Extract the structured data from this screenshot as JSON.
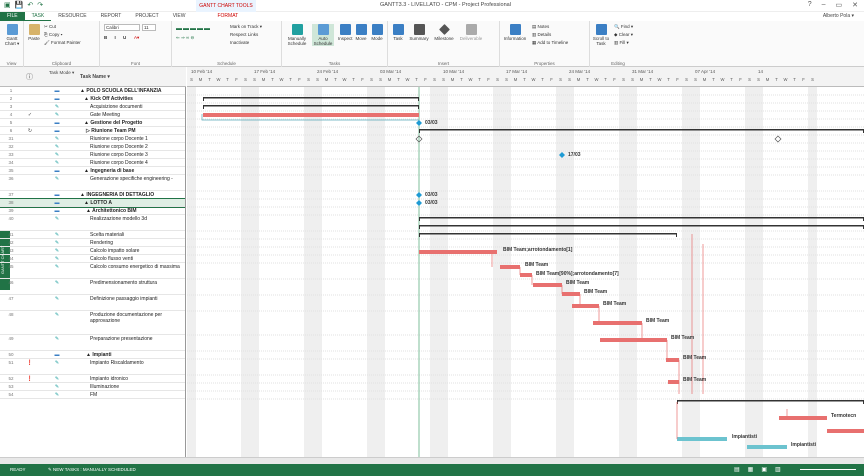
{
  "window": {
    "title": "GANTT3.3 - LIVELLATO - CPM - Project Professional",
    "tools_label": "GANTT CHART TOOLS",
    "user": "Alberto Pola ▾",
    "controls": [
      "?",
      "–",
      "▭",
      "✕"
    ]
  },
  "tabs": [
    "FILE",
    "TASK",
    "RESOURCE",
    "REPORT",
    "PROJECT",
    "VIEW",
    "FORMAT"
  ],
  "ribbon": {
    "groups": [
      "View",
      "Clipboard",
      "Font",
      "Schedule",
      "Tasks",
      "Insert",
      "Properties",
      "Editing"
    ],
    "view_btn": "Gantt Chart ▾",
    "paste": "Paste",
    "cut": "Cut",
    "copy": "Copy ▾",
    "format_painter": "Format Painter",
    "font_name": "Calibri",
    "font_size": "11",
    "mark_on_track": "Mark on Track ▾",
    "respect_links": "Respect Links",
    "inactivate": "Inactivate",
    "manually_schedule": "Manually Schedule",
    "auto_schedule": "Auto Schedule",
    "inspect": "Inspect",
    "move": "Move",
    "mode": "Mode",
    "task": "Task",
    "summary": "Summary",
    "milestone": "Milestone",
    "deliverable": "Deliverable",
    "information": "Information",
    "notes": "Notes",
    "details": "Details",
    "add_to_timeline": "Add to Timeline",
    "scroll_to_task": "Scroll to Task",
    "find": "Find ▾",
    "clear": "Clear ▾",
    "fill": "Fill ▾"
  },
  "grid": {
    "hdr_mode": "Task Mode ▾",
    "hdr_name": "Task Name ▾",
    "rows": [
      {
        "id": "1",
        "ind": "",
        "mode": "▬",
        "name": "▲ POLO SCUOLA DELL'INFANZIA",
        "bold": true
      },
      {
        "id": "2",
        "ind": "",
        "mode": "▬",
        "name": "▲ Kick Off Activities",
        "bold": true
      },
      {
        "id": "3",
        "ind": "",
        "mode": "✎",
        "name": "Acquisizione documenti",
        "bold": false
      },
      {
        "id": "4",
        "ind": "✓",
        "mode": "✎",
        "name": "Gate Meeting",
        "bold": false
      },
      {
        "id": "5",
        "ind": "",
        "mode": "▬",
        "name": "▲ Gestione del Progetto",
        "bold": true
      },
      {
        "id": "6",
        "ind": "↻",
        "mode": "▬",
        "name": "▷ Riunione Team PM",
        "bold": true
      },
      {
        "id": "31",
        "ind": "",
        "mode": "✎",
        "name": "Riunione corpo Docente 1",
        "bold": false
      },
      {
        "id": "32",
        "ind": "",
        "mode": "✎",
        "name": "Riunione corpo Docente 2",
        "bold": false
      },
      {
        "id": "33",
        "ind": "",
        "mode": "✎",
        "name": "Riunione corpo Docente 3",
        "bold": false
      },
      {
        "id": "34",
        "ind": "",
        "mode": "✎",
        "name": "Riunione corpo Docente 4",
        "bold": false
      },
      {
        "id": "35",
        "ind": "",
        "mode": "▬",
        "name": "▲ Ingegneria di base",
        "bold": true
      },
      {
        "id": "36",
        "ind": "",
        "mode": "✎",
        "name": "Generazione specifiche engineering -",
        "bold": false
      },
      {
        "id": "37",
        "ind": "",
        "mode": "▬",
        "name": "▲ INGEGNERIA DI DETTAGLIO",
        "bold": true
      },
      {
        "id": "38",
        "ind": "",
        "mode": "▬",
        "name": "▲ LOTTO A",
        "bold": true
      },
      {
        "id": "39",
        "ind": "",
        "mode": "▬",
        "name": "▲ Architettonico BIM",
        "bold": true
      },
      {
        "id": "40",
        "ind": "",
        "mode": "✎",
        "name": "Realizzazione modello 3d",
        "bold": false
      },
      {
        "id": "41",
        "ind": "",
        "mode": "✎",
        "name": "Scelta materiali",
        "bold": false
      },
      {
        "id": "42",
        "ind": "",
        "mode": "✎",
        "name": "Rendering",
        "bold": false
      },
      {
        "id": "43",
        "ind": "",
        "mode": "✎",
        "name": "Calcolo impatto solare",
        "bold": false
      },
      {
        "id": "44",
        "ind": "",
        "mode": "✎",
        "name": "Calcolo flusso venti",
        "bold": false
      },
      {
        "id": "45",
        "ind": "",
        "mode": "✎",
        "name": "Calcolo consumo energetico di massima",
        "bold": false
      },
      {
        "id": "46",
        "ind": "",
        "mode": "✎",
        "name": "Predimensionamento struttura",
        "bold": false
      },
      {
        "id": "47",
        "ind": "",
        "mode": "✎",
        "name": "Definizione passaggio impianti",
        "bold": false
      },
      {
        "id": "48",
        "ind": "",
        "mode": "✎",
        "name": "Produzione documentazione per approvazione",
        "bold": false
      },
      {
        "id": "49",
        "ind": "",
        "mode": "✎",
        "name": "Preparazione presentazione",
        "bold": false
      },
      {
        "id": "50",
        "ind": "",
        "mode": "▬",
        "name": "▲ Impianti",
        "bold": true
      },
      {
        "id": "51",
        "ind": "❗",
        "mode": "✎",
        "name": "Impianto Riscaldamento",
        "bold": false
      },
      {
        "id": "52",
        "ind": "❗",
        "mode": "✎",
        "name": "Impianto idronico",
        "bold": false
      },
      {
        "id": "53",
        "ind": "",
        "mode": "✎",
        "name": "Illuminazione",
        "bold": false
      },
      {
        "id": "54",
        "ind": "",
        "mode": "✎",
        "name": "FM",
        "bold": false
      }
    ]
  },
  "sidebar_label": "GANTT CHART",
  "timescale": {
    "weeks": [
      "10 Feb '14",
      "17 Feb '14",
      "24 Feb '14",
      "03 Mar '14",
      "10 Mar '14",
      "17 Mar '14",
      "24 Mar '14",
      "31 Mar '14",
      "07 Apr '14",
      "14"
    ],
    "days": [
      "S",
      "M",
      "T",
      "W",
      "T",
      "F",
      "S"
    ]
  },
  "chart_labels": {
    "gate_date": "03/03",
    "milestone_date": "17/03",
    "bim_rounding": "BIM Team;arrotondamento[1]",
    "bim_team": "BIM Team",
    "bim_90": "BIM Team[90%];arrotondamento[7]",
    "impiantisti": "Impiantisti",
    "termotecnici": "Termotecn"
  },
  "status": {
    "ready": "READY",
    "new_tasks": "NEW TASKS : MANUALLY SCHEDULED"
  },
  "colors": {
    "accent": "#217346",
    "critical_bar": "#e8706f",
    "normal_bar": "#6cc3cf",
    "milestone": "#1f9bd4"
  }
}
